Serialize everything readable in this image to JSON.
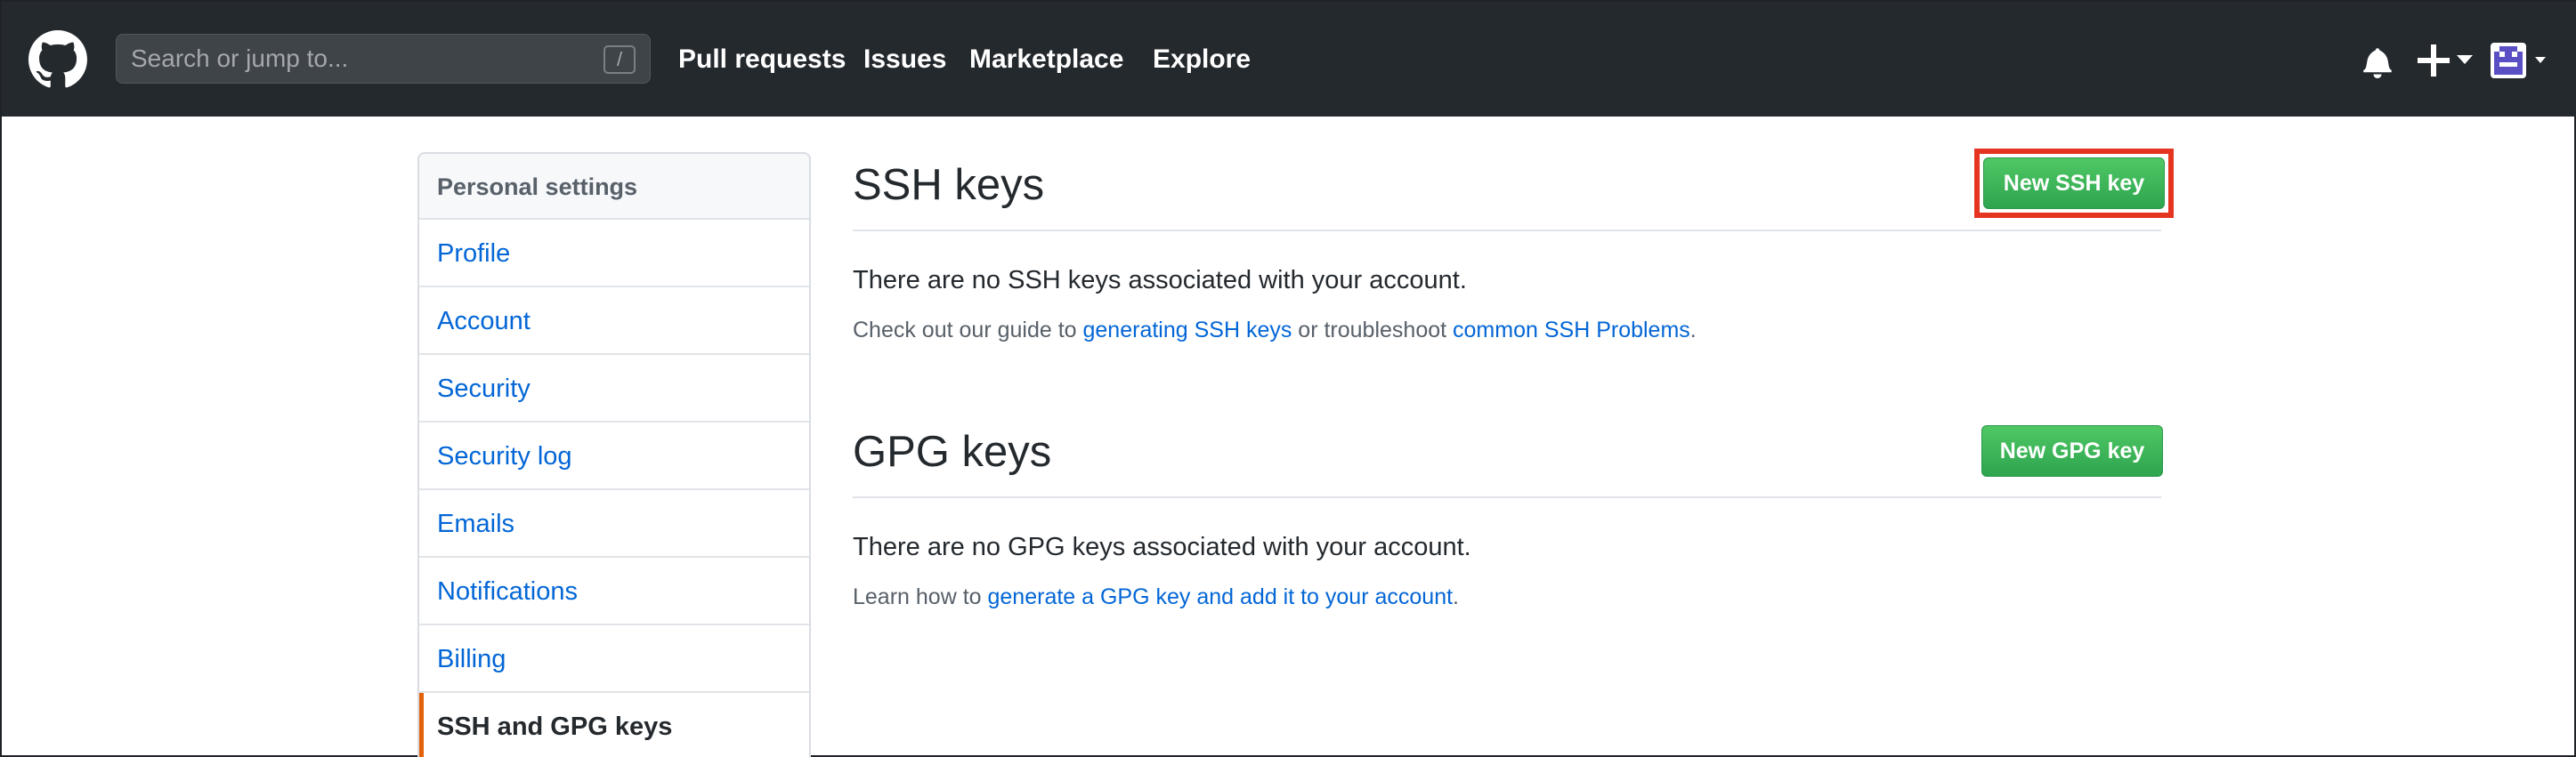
{
  "header": {
    "search_placeholder": "Search or jump to...",
    "search_key_hint": "/",
    "nav": {
      "pull_requests": "Pull requests",
      "issues": "Issues",
      "marketplace": "Marketplace",
      "explore": "Explore"
    },
    "icons": {
      "logo": "github-octocat-icon",
      "bell": "bell-icon",
      "create": "plus-icon",
      "avatar": "avatar"
    }
  },
  "sidebar": {
    "header": "Personal settings",
    "items": [
      {
        "label": "Profile"
      },
      {
        "label": "Account"
      },
      {
        "label": "Security"
      },
      {
        "label": "Security log"
      },
      {
        "label": "Emails"
      },
      {
        "label": "Notifications"
      },
      {
        "label": "Billing"
      },
      {
        "label": "SSH and GPG keys",
        "selected": true
      }
    ]
  },
  "ssh": {
    "title": "SSH keys",
    "button": "New SSH key",
    "empty_message": "There are no SSH keys associated with your account.",
    "help_prefix": "Check out our guide to ",
    "help_link1": "generating SSH keys",
    "help_middle": " or troubleshoot ",
    "help_link2": "common SSH Problems",
    "help_suffix": "."
  },
  "gpg": {
    "title": "GPG keys",
    "button": "New GPG key",
    "empty_message": "There are no GPG keys associated with your account.",
    "help_prefix": "Learn how to ",
    "help_link": "generate a GPG key and add it to your account",
    "help_suffix": "."
  },
  "colors": {
    "header_bg": "#24292e",
    "link": "#0366d6",
    "button_green": "#2ea44f",
    "selected_accent": "#e36209",
    "highlight_red": "#e5341f"
  }
}
